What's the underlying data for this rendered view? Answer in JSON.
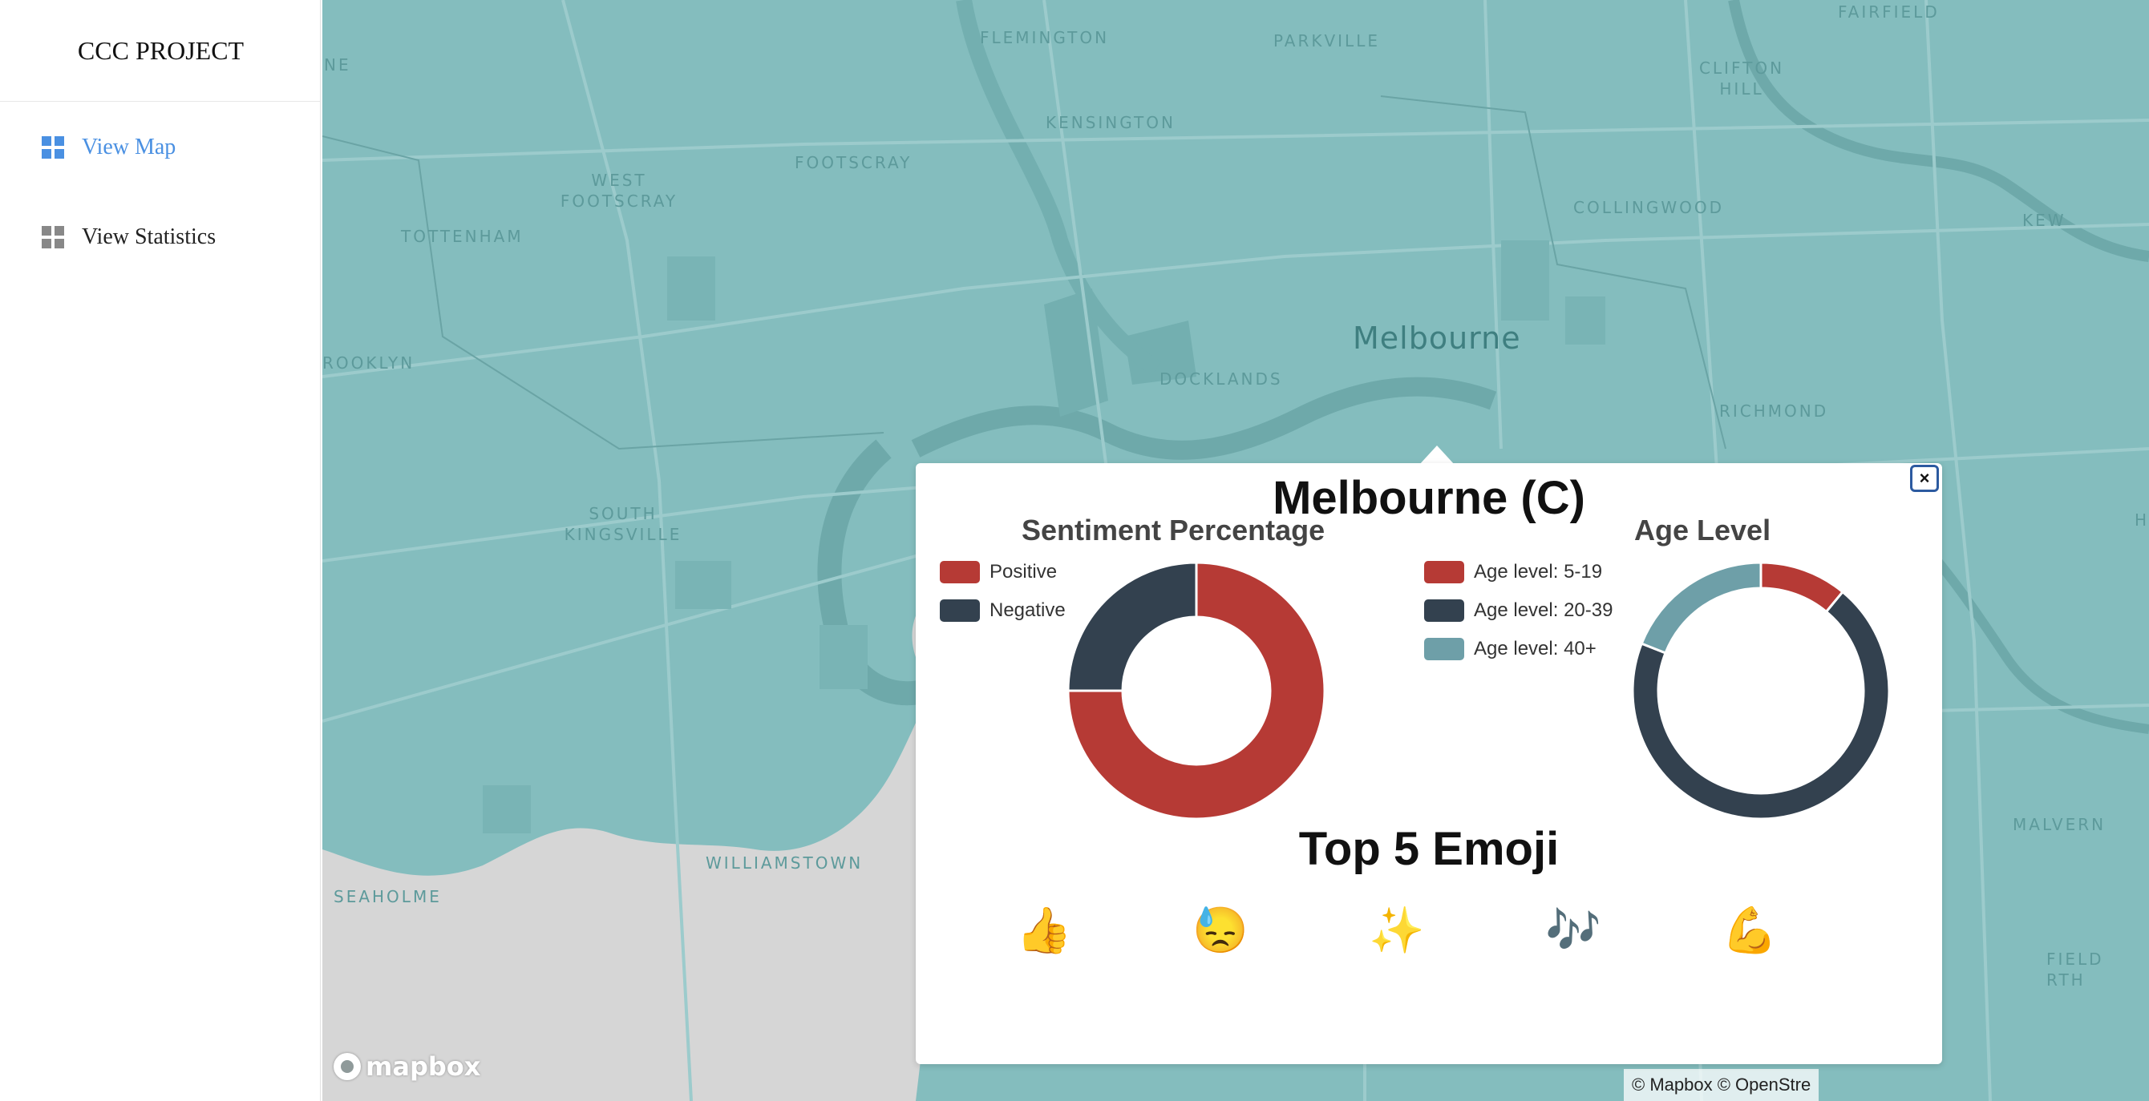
{
  "sidebar": {
    "brand": "CCC PROJECT",
    "items": [
      {
        "label": "View Map",
        "active": true,
        "icon": "grid-icon"
      },
      {
        "label": "View Statistics",
        "active": false,
        "icon": "grid-icon"
      }
    ]
  },
  "map": {
    "city_label": "Melbourne",
    "places": [
      "FLEMINGTON",
      "PARKVILLE",
      "FAIRFIELD",
      "CLIFTON HILL",
      "KENSINGTON",
      "FOOTSCRAY",
      "WEST FOOTSCRAY",
      "TOTTENHAM",
      "COLLINGWOOD",
      "KEW",
      "DOCKLANDS",
      "RICHMOND",
      "ROOKLYN",
      "SOUTH KINGSVILLE",
      "WILLIAMSTOWN",
      "SEAHOLME",
      "MALVERN",
      "FIELD",
      "RTH",
      "NE",
      "H"
    ],
    "logo_text": "mapbox",
    "attribution": "© Mapbox © OpenStre"
  },
  "popup": {
    "title": "Melbourne (C)",
    "close_label": "×",
    "sentiment": {
      "title": "Sentiment Percentage",
      "legend": [
        {
          "label": "Positive",
          "color": "#b63a35"
        },
        {
          "label": "Negative",
          "color": "#33414f"
        }
      ]
    },
    "age": {
      "title": "Age Level",
      "legend": [
        {
          "label": "Age level: 5-19",
          "color": "#b63a35"
        },
        {
          "label": "Age level: 20-39",
          "color": "#33414f"
        },
        {
          "label": "Age level: 40+",
          "color": "#6e9fa8"
        }
      ]
    },
    "emoji": {
      "title": "Top 5 Emoji",
      "items": [
        "👍",
        "😓",
        "✨",
        "🎶",
        "💪"
      ]
    }
  },
  "chart_data": [
    {
      "type": "pie",
      "title": "Sentiment Percentage",
      "categories": [
        "Positive",
        "Negative"
      ],
      "values": [
        75,
        25
      ],
      "colors": [
        "#b63a35",
        "#33414f"
      ],
      "legend": "left"
    },
    {
      "type": "pie",
      "title": "Age Level",
      "categories": [
        "Age level: 5-19",
        "Age level: 20-39",
        "Age level: 40+"
      ],
      "values": [
        11,
        70,
        19
      ],
      "colors": [
        "#b63a35",
        "#33414f",
        "#6e9fa8"
      ],
      "legend": "left"
    }
  ]
}
